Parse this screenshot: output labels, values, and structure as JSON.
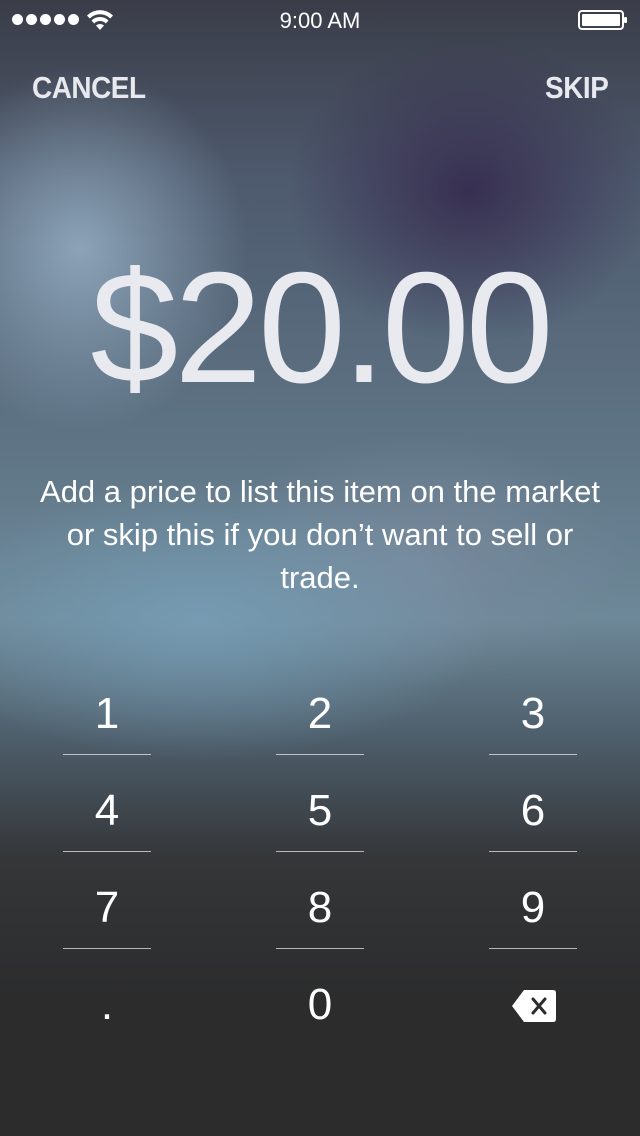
{
  "status_bar": {
    "time": "9:00 AM",
    "signal_icon": "signal-dots-icon",
    "wifi_icon": "wifi-icon",
    "battery_icon": "battery-icon"
  },
  "nav": {
    "cancel_label": "CANCEL",
    "skip_label": "SKIP"
  },
  "price": {
    "amount": "$20.00"
  },
  "hint": {
    "text": "Add a price to list this item on the market or skip this if you don’t want to sell or trade."
  },
  "keypad": {
    "keys": [
      "1",
      "2",
      "3",
      "4",
      "5",
      "6",
      "7",
      "8",
      "9",
      ".",
      "0"
    ],
    "delete_icon": "backspace-icon"
  },
  "colors": {
    "text": "#ffffff",
    "price_text": "#e9e9f0",
    "background_dark": "#2c2c2d"
  }
}
